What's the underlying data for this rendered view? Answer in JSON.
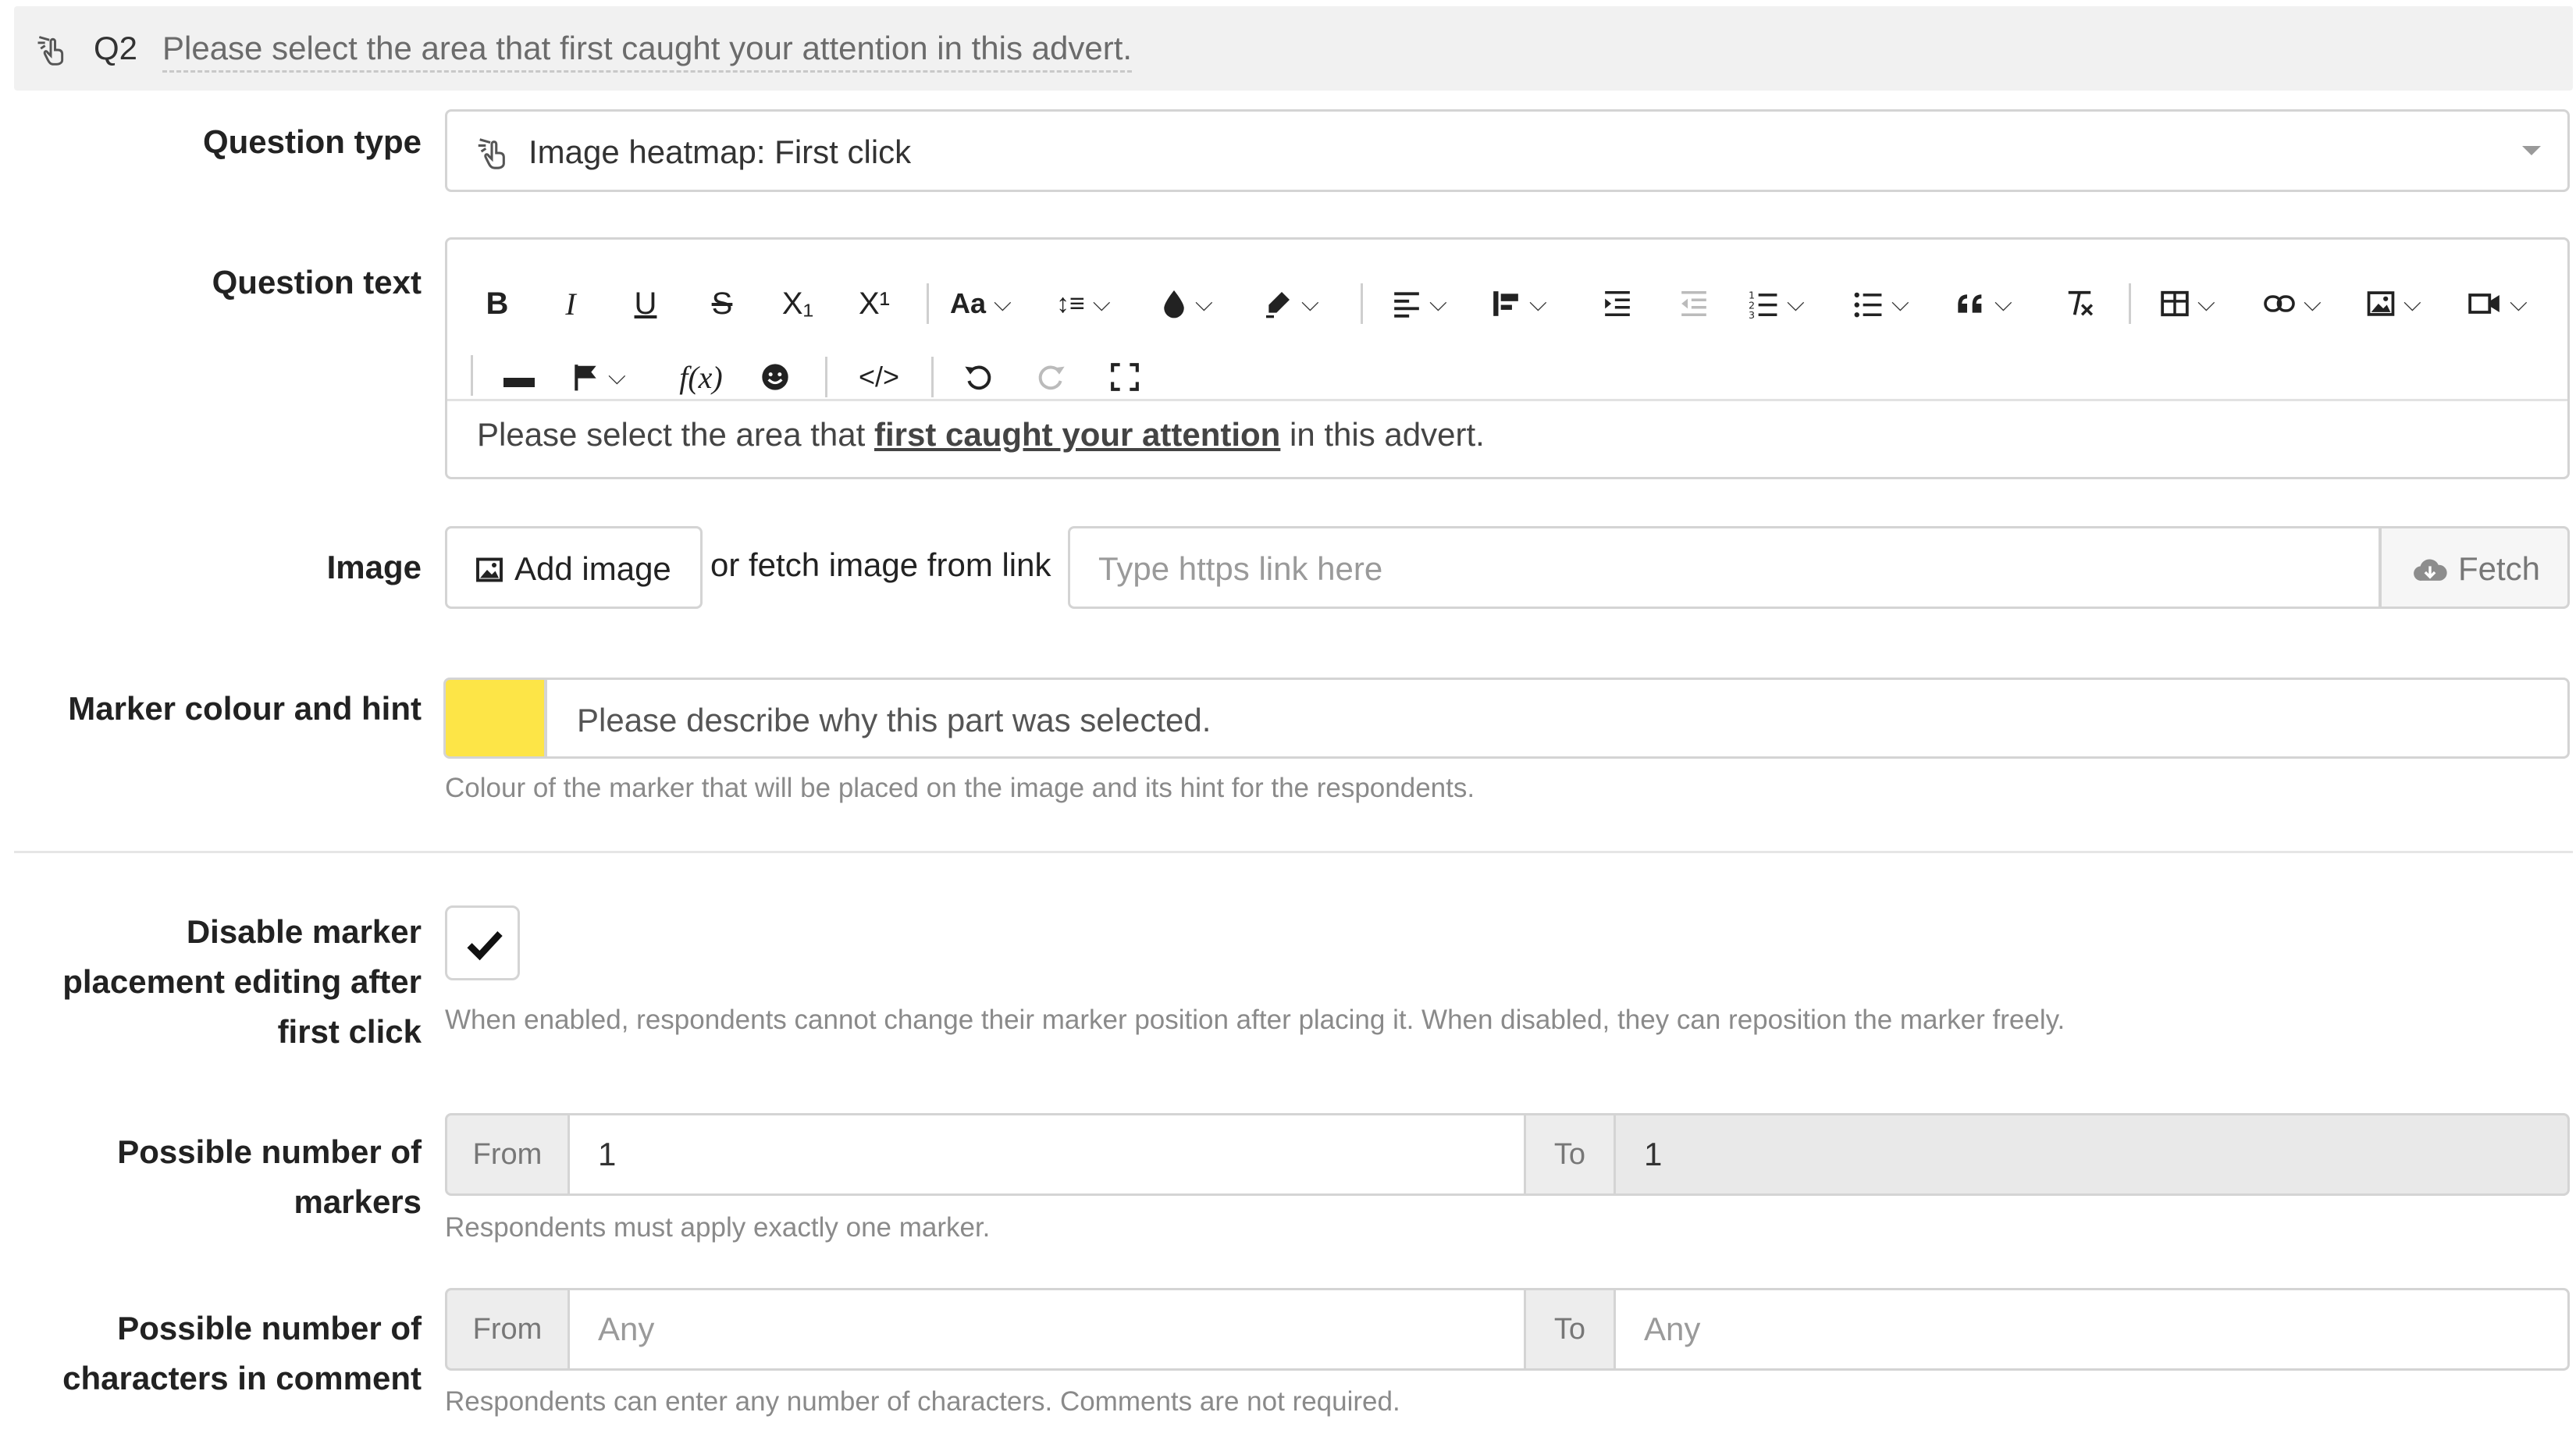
{
  "header": {
    "qnum": "Q2",
    "title": "Please select the area that first caught your attention in this advert.",
    "icon": "heatmap-click-icon"
  },
  "question_type": {
    "label": "Question type",
    "value": "Image heatmap: First click",
    "icon": "heatmap-click-icon"
  },
  "question_text": {
    "label": "Question text",
    "content_before": "Please select the area that ",
    "content_emphasis": "first caught your attention",
    "content_after": " in this advert."
  },
  "toolbar": {
    "bold": "B",
    "italic": "I",
    "underline": "U",
    "strike": "S",
    "subscript": "X₁",
    "superscript": "X¹",
    "font_size": "Aa",
    "line_height": "↕≡",
    "blocks": "▬",
    "formula": "f(x)",
    "code": "</>"
  },
  "image": {
    "label": "Image",
    "add_button": "Add image",
    "or_fetch": "or fetch image from link",
    "link_placeholder": "Type https link here",
    "fetch_button": "Fetch"
  },
  "marker": {
    "label": "Marker colour and hint",
    "color": "#fde547",
    "hint_value": "Please describe why this part was selected.",
    "help": "Colour of the marker that will be placed on the image and its hint for the respondents."
  },
  "disable_edit": {
    "label_line1": "Disable marker",
    "label_line2": "placement editing after",
    "label_line3": "first click",
    "checked": true,
    "help": "When enabled, respondents cannot change their marker position after placing it. When disabled, they can reposition the marker freely."
  },
  "markers_count": {
    "label_line1": "Possible number of",
    "label_line2": "markers",
    "from_label": "From",
    "from_value": "1",
    "to_label": "To",
    "to_value": "1",
    "help": "Respondents must apply exactly one marker."
  },
  "chars_count": {
    "label_line1": "Possible number of",
    "label_line2": "characters in comment",
    "from_label": "From",
    "from_placeholder": "Any",
    "to_label": "To",
    "to_placeholder": "Any",
    "help": "Respondents can enter any number of characters. Comments are not required."
  }
}
